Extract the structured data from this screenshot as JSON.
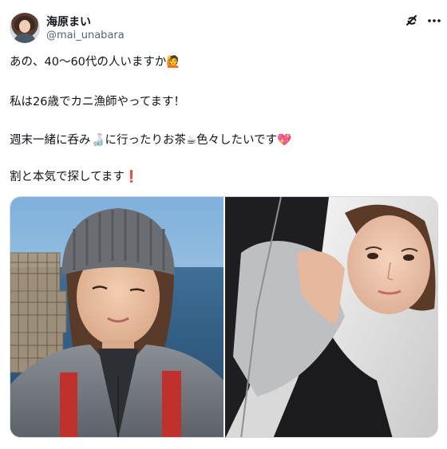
{
  "author": {
    "display_name": "海原まい",
    "handle": "@mai_unabara"
  },
  "post": {
    "lines": [
      "あの、40〜60代の人いますか🙋",
      "私は26歳でカニ漁師やってます！",
      "週末一緒に呑み🍶に行ったりお茶☕色々したいです💖",
      "割と本気で探してます❗"
    ],
    "media": [
      {
        "alt": "Selfie of a woman in a grey knit beanie and winter jacket on a boat, crab traps and sea behind"
      },
      {
        "alt": "Selfie of a woman lying on a pillow in a grey top and black zip jacket"
      }
    ]
  },
  "icons": {
    "grok": "grok-icon",
    "more": "more-options-icon"
  },
  "colors": {
    "text": "#0f1419",
    "secondary": "#536471",
    "border": "#cfd9de"
  }
}
